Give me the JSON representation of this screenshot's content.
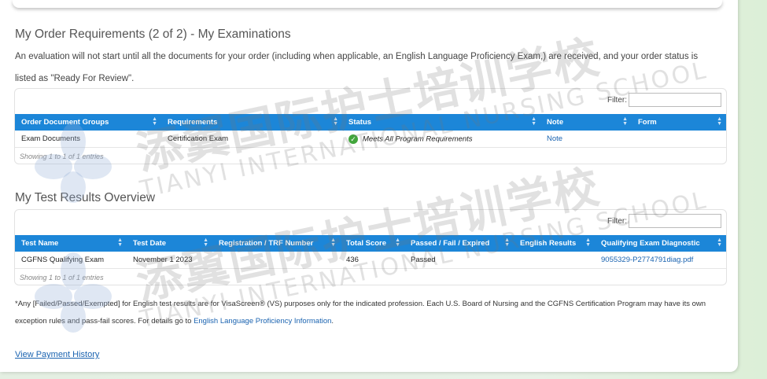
{
  "order_requirements": {
    "title": "My Order Requirements (2 of 2) - My Examinations",
    "intro": "An evaluation will not start until all the documents for your order (including when applicable, an English Language Proficiency Exam,) are received, and your order status is listed as \"Ready For Review\".",
    "filter_label": "Filter:",
    "columns": [
      "Order Document Groups",
      "Requirements",
      "Status",
      "Note",
      "Form"
    ],
    "rows": [
      {
        "group": "Exam Documents",
        "requirement": "Certification Exam",
        "status": "Meets All Program Requirements",
        "note": "Note",
        "form": ""
      }
    ],
    "showing": "Showing 1 to 1 of 1 entries"
  },
  "test_results": {
    "title": "My Test Results Overview",
    "filter_label": "Filter:",
    "columns": [
      "Test Name",
      "Test Date",
      "Registration / TRF Number",
      "Total Score",
      "Passed / Fail / Expired",
      "English Results",
      "Qualifying Exam Diagnostic"
    ],
    "rows": [
      {
        "name": "CGFNS Qualifying Exam",
        "date": "November 1 2023",
        "registration": "",
        "score": "436",
        "result": "Passed",
        "english": "",
        "diagnostic": "9055329-P2774791diag.pdf"
      }
    ],
    "showing": "Showing 1 to 1 of 1 entries"
  },
  "footnote": {
    "text": "*Any [Failed/Passed/Exempted] for English test results are for VisaScreen® (VS) purposes only for the indicated profession.  Each U.S. Board of Nursing and the CGFNS Certification Program may have its own exception rules and pass-fail scores. For details go to ",
    "link": "English Language Proficiency Information",
    "end": "."
  },
  "view_payment_history": "View Payment History",
  "watermark": {
    "cn": "添翼国际护士培训学校",
    "en": "TIANYI INTERNATIONAL NURSING SCHOOL"
  },
  "colors": {
    "header": "#1c86d8",
    "link": "#1a63b0",
    "check": "#42a63c"
  }
}
